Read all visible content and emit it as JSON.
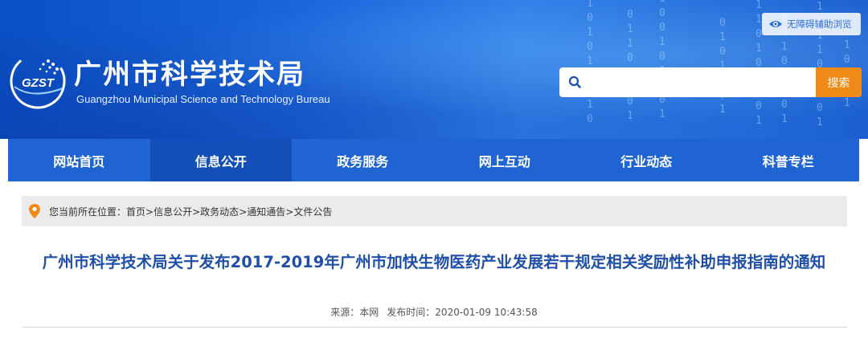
{
  "header": {
    "site_title": "广州市科学技术局",
    "site_subtitle": "Guangzhou Municipal Science and Technology Bureau",
    "logo_text": "GZST",
    "accessibility_label": "无障碍辅助浏览",
    "search": {
      "placeholder": "",
      "button_label": "搜索"
    }
  },
  "nav": {
    "items": [
      {
        "label": "网站首页"
      },
      {
        "label": "信息公开"
      },
      {
        "label": "政务服务"
      },
      {
        "label": "网上互动"
      },
      {
        "label": "行业动态"
      },
      {
        "label": "科普专栏"
      }
    ],
    "active_index": 1
  },
  "breadcrumb": {
    "prefix": "您当前所在位置：",
    "items": [
      "首页",
      "信息公开",
      "政务动态",
      "通知通告",
      "文件公告"
    ],
    "separator": ">"
  },
  "article": {
    "title": "广州市科学技术局关于发布2017-2019年广州市加快生物医药产业发展若干规定相关奖励性补助申报指南的通知",
    "source_label": "来源：",
    "source_value": "本网",
    "published_label": "发布时间：",
    "published_value": "2020-01-09 10:43:58"
  },
  "colors": {
    "header_blue": "#1a66dc",
    "nav_blue": "#1f64d2",
    "nav_active": "#124fb8",
    "search_button": "#f08a17",
    "title_blue": "#1f4fa8",
    "pin_orange": "#f08a17"
  },
  "icons": {
    "logo": "gzst-logo-icon",
    "accessibility": "eye-icon",
    "search": "search-icon",
    "location": "location-pin-icon"
  }
}
